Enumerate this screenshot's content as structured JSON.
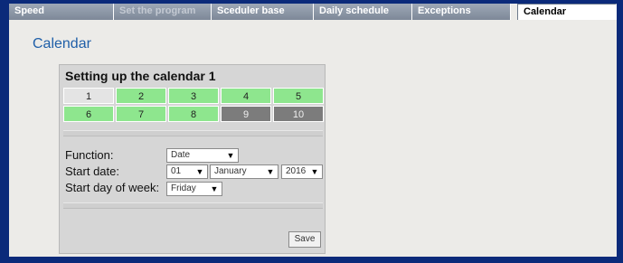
{
  "tabs": [
    {
      "label": "Speed",
      "state": "normal"
    },
    {
      "label": "Set the program",
      "state": "disabled"
    },
    {
      "label": "Sceduler base",
      "state": "normal"
    },
    {
      "label": "Daily schedule",
      "state": "normal"
    },
    {
      "label": "Exceptions",
      "state": "normal"
    },
    {
      "label": "Calendar",
      "state": "active"
    }
  ],
  "page_title": "Calendar",
  "panel": {
    "heading": "Setting up the calendar 1",
    "calendars": [
      {
        "label": "1",
        "status": "selected"
      },
      {
        "label": "2",
        "status": "enabled"
      },
      {
        "label": "3",
        "status": "enabled"
      },
      {
        "label": "4",
        "status": "enabled"
      },
      {
        "label": "5",
        "status": "enabled"
      },
      {
        "label": "6",
        "status": "enabled"
      },
      {
        "label": "7",
        "status": "enabled"
      },
      {
        "label": "8",
        "status": "enabled"
      },
      {
        "label": "9",
        "status": "disabled"
      },
      {
        "label": "10",
        "status": "disabled"
      }
    ],
    "function_label": "Function:",
    "function_value": "Date",
    "start_date_label": "Start date:",
    "start_day_value": "01",
    "start_month_value": "January",
    "start_year_value": "2016",
    "start_dow_label": "Start day of week:",
    "start_dow_value": "Friday",
    "save_label": "Save"
  },
  "colors": {
    "frame": "#0b2a7a",
    "title": "#1f5fa8",
    "enabled": "#8ee68e",
    "disabled": "#7c7c7c"
  }
}
